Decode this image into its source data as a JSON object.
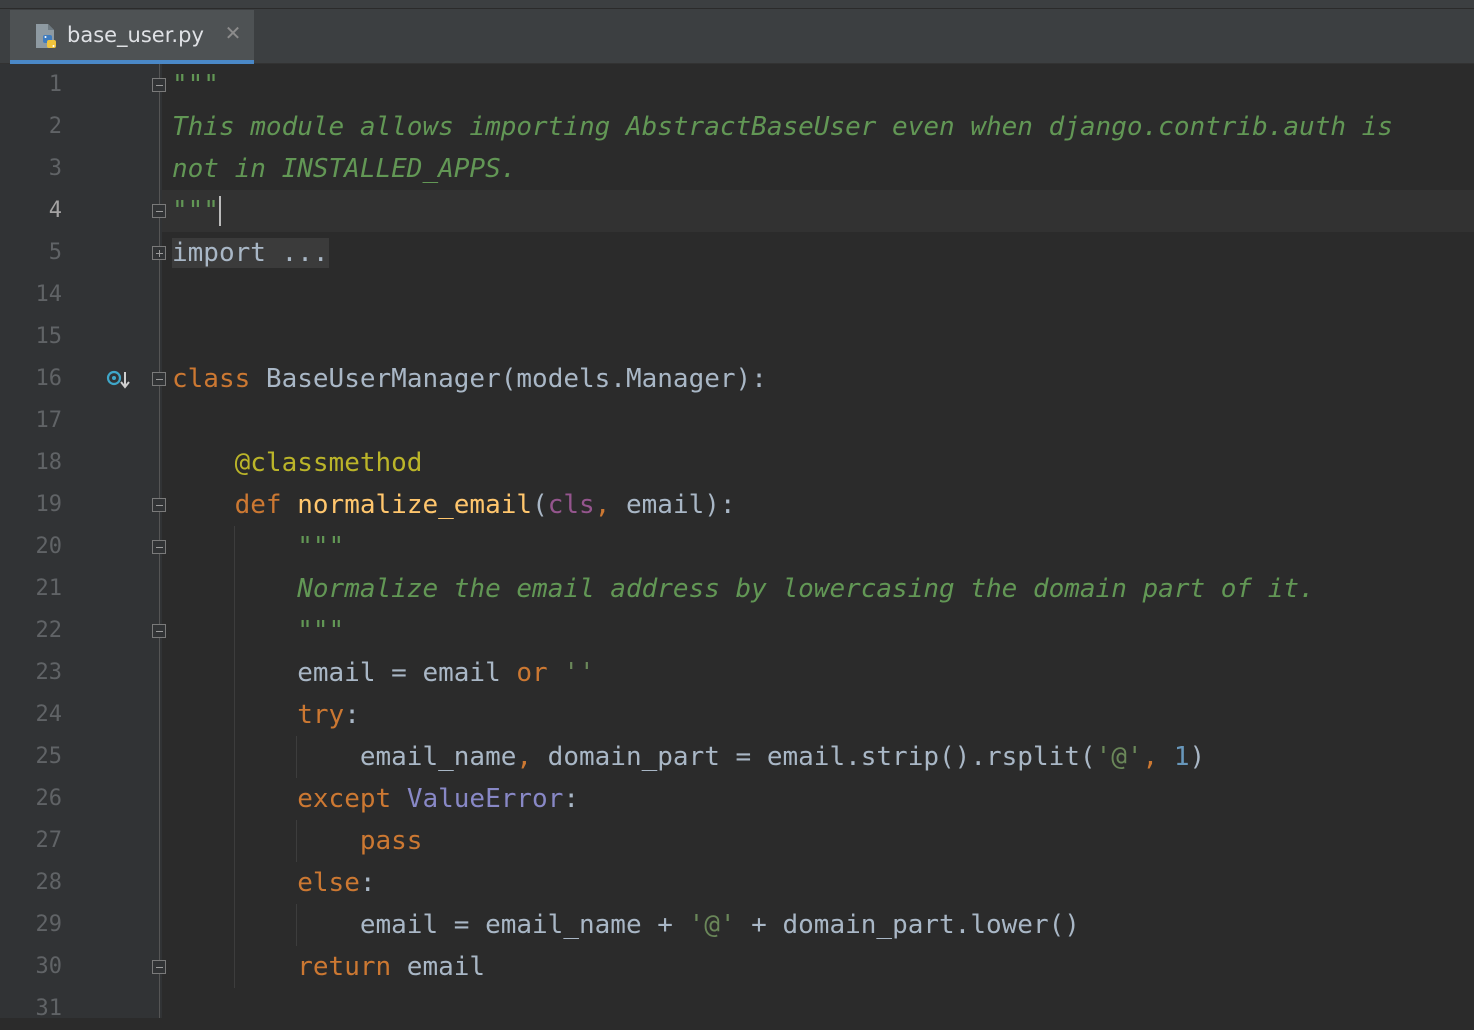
{
  "tab": {
    "filename": "base_user.py",
    "file_icon": "python-file-icon",
    "close_icon": "close-icon",
    "close_glyph": "✕"
  },
  "gutter": {
    "override_icon": "overriding-method-icon"
  },
  "editor": {
    "current_line": "4",
    "lines": [
      {
        "num": "1",
        "tokens": [
          {
            "t": "\"\"\"",
            "c": "doc"
          }
        ]
      },
      {
        "num": "2",
        "tokens": [
          {
            "t": "This module allows importing AbstractBaseUser even when django.contrib.auth is",
            "c": "doc"
          }
        ]
      },
      {
        "num": "3",
        "tokens": [
          {
            "t": "not in INSTALLED_APPS.",
            "c": "doc"
          }
        ]
      },
      {
        "num": "4",
        "tokens": [
          {
            "t": "\"\"\"",
            "c": "doc"
          }
        ]
      },
      {
        "num": "5",
        "tokens": [
          {
            "t": "import ...",
            "c": "fold-code"
          }
        ]
      },
      {
        "num": "14",
        "tokens": []
      },
      {
        "num": "15",
        "tokens": []
      },
      {
        "num": "16",
        "tokens": [
          {
            "t": "class",
            "c": "kw"
          },
          {
            "t": " BaseUserManager(models.Manager):",
            "c": ""
          }
        ]
      },
      {
        "num": "17",
        "tokens": []
      },
      {
        "num": "18",
        "tokens": [
          {
            "t": "    ",
            "c": ""
          },
          {
            "t": "@classmethod",
            "c": "dec"
          }
        ]
      },
      {
        "num": "19",
        "tokens": [
          {
            "t": "    ",
            "c": ""
          },
          {
            "t": "def",
            "c": "kw"
          },
          {
            "t": " ",
            "c": ""
          },
          {
            "t": "normalize_email",
            "c": "fn"
          },
          {
            "t": "(",
            "c": ""
          },
          {
            "t": "cls",
            "c": "self"
          },
          {
            "t": ",",
            "c": "kw"
          },
          {
            "t": " email):",
            "c": ""
          }
        ]
      },
      {
        "num": "20",
        "tokens": [
          {
            "t": "        ",
            "c": ""
          },
          {
            "t": "\"\"\"",
            "c": "doc"
          }
        ]
      },
      {
        "num": "21",
        "tokens": [
          {
            "t": "        ",
            "c": ""
          },
          {
            "t": "Normalize the email address by lowercasing the domain part of it.",
            "c": "doc"
          }
        ]
      },
      {
        "num": "22",
        "tokens": [
          {
            "t": "        ",
            "c": ""
          },
          {
            "t": "\"\"\"",
            "c": "doc"
          }
        ]
      },
      {
        "num": "23",
        "tokens": [
          {
            "t": "        email = email ",
            "c": ""
          },
          {
            "t": "or",
            "c": "kw"
          },
          {
            "t": " ",
            "c": ""
          },
          {
            "t": "''",
            "c": "str"
          }
        ]
      },
      {
        "num": "24",
        "tokens": [
          {
            "t": "        ",
            "c": ""
          },
          {
            "t": "try",
            "c": "kw"
          },
          {
            "t": ":",
            "c": ""
          }
        ]
      },
      {
        "num": "25",
        "tokens": [
          {
            "t": "            email_name",
            "c": ""
          },
          {
            "t": ",",
            "c": "kw"
          },
          {
            "t": " domain_part = email.strip().rsplit(",
            "c": ""
          },
          {
            "t": "'@'",
            "c": "str"
          },
          {
            "t": ",",
            "c": "kw"
          },
          {
            "t": " ",
            "c": ""
          },
          {
            "t": "1",
            "c": "num"
          },
          {
            "t": ")",
            "c": ""
          }
        ]
      },
      {
        "num": "26",
        "tokens": [
          {
            "t": "        ",
            "c": ""
          },
          {
            "t": "except",
            "c": "kw"
          },
          {
            "t": " ",
            "c": ""
          },
          {
            "t": "ValueError",
            "c": "builtin"
          },
          {
            "t": ":",
            "c": ""
          }
        ]
      },
      {
        "num": "27",
        "tokens": [
          {
            "t": "            ",
            "c": ""
          },
          {
            "t": "pass",
            "c": "kw"
          }
        ]
      },
      {
        "num": "28",
        "tokens": [
          {
            "t": "        ",
            "c": ""
          },
          {
            "t": "else",
            "c": "kw"
          },
          {
            "t": ":",
            "c": ""
          }
        ]
      },
      {
        "num": "29",
        "tokens": [
          {
            "t": "            email = email_name + ",
            "c": ""
          },
          {
            "t": "'@'",
            "c": "str"
          },
          {
            "t": " + domain_part.lower()",
            "c": ""
          }
        ]
      },
      {
        "num": "30",
        "tokens": [
          {
            "t": "        ",
            "c": ""
          },
          {
            "t": "return",
            "c": "kw"
          },
          {
            "t": " email",
            "c": ""
          }
        ]
      },
      {
        "num": "31",
        "tokens": []
      }
    ]
  },
  "colors": {
    "background": "#2b2b2b",
    "gutter": "#313335",
    "keyword": "#cc7832",
    "docstring": "#629755",
    "decorator": "#bbb529",
    "function": "#ffc66d",
    "string": "#6a8759",
    "number": "#6897bb",
    "self_param": "#94558d",
    "builtin": "#8888c6",
    "tab_underline": "#4a88c7"
  }
}
